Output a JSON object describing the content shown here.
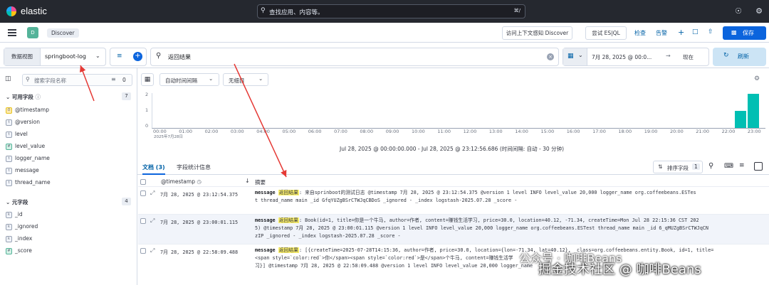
{
  "app": {
    "brand": "elastic"
  },
  "global_search": {
    "placeholder": "查找应用、内容等。",
    "shortcut": "⌘/"
  },
  "subbar": {
    "app_badge": "D",
    "breadcrumb": "Discover",
    "access_button": "访问上下文感知 Discover",
    "esql_button": "尝试 ES|QL",
    "inspect": "检查",
    "alerts": "告警",
    "save": "保存"
  },
  "querybar": {
    "data_view_label": "数据视图",
    "data_view_value": "springboot-log",
    "query": "返回结果",
    "date_start": "7月 28, 2025 @ 00:0...",
    "arrow": "→",
    "date_end": "现在",
    "refresh": "刷新"
  },
  "sidebar": {
    "search_placeholder": "搜索字段名称",
    "filter_count": "0",
    "available_label": "可用字段",
    "available_count": "7",
    "available_fields": [
      {
        "type": "date",
        "name": "@timestamp"
      },
      {
        "type": "t",
        "name": "@version"
      },
      {
        "type": "t",
        "name": "level"
      },
      {
        "type": "#",
        "name": "level_value"
      },
      {
        "type": "t",
        "name": "logger_name"
      },
      {
        "type": "t",
        "name": "message"
      },
      {
        "type": "t",
        "name": "thread_name"
      }
    ],
    "meta_label": "元字段",
    "meta_count": "4",
    "meta_fields": [
      {
        "type": "k",
        "name": "_id"
      },
      {
        "type": "k",
        "name": "_ignored"
      },
      {
        "type": "k",
        "name": "_index"
      },
      {
        "type": "#",
        "name": "_score"
      }
    ]
  },
  "toolbar": {
    "interval": "自动时间间隔",
    "breakdown": "无细目"
  },
  "chart_data": {
    "type": "bar",
    "y_ticks": [
      "2",
      "1",
      "0"
    ],
    "x_ticks": [
      "00:00",
      "01:00",
      "02:00",
      "03:00",
      "04:00",
      "05:00",
      "06:00",
      "07:00",
      "08:00",
      "09:00",
      "10:00",
      "11:00",
      "12:00",
      "13:00",
      "14:00",
      "15:00",
      "16:00",
      "17:00",
      "18:00",
      "19:00",
      "20:00",
      "21:00",
      "22:00",
      "23:00"
    ],
    "x_sub": "2025年7月28日",
    "bars": [
      {
        "x": "22:30",
        "value": 1
      },
      {
        "x": "23:00",
        "value": 2
      }
    ],
    "ylim": [
      0,
      2
    ],
    "caption": "Jul 28, 2025 @ 00:00:00.000 - Jul 28, 2025 @ 23:12:56.686  (时间间隔: 自动 - 30 分钟)"
  },
  "tabs": {
    "docs": "文档 (3)",
    "stats": "字段统计信息"
  },
  "table": {
    "sort_button": "排序字段",
    "sort_count": "1",
    "col_timestamp": "@timestamp",
    "col_summary": "摘要",
    "rows": [
      {
        "ts": "7月 28, 2025 @ 23:12:54.375",
        "line1_pre": "message ",
        "line1_hl": "返回结果",
        "line1_post": ": 来自sprinboot的测试日志 @timestamp 7月 28, 2025 @ 23:12:54.375 @version 1 level INFO level_value 20,000 logger_name org.coffeebeans.ESTes",
        "line2": "t thread_name main _id GfqYUZgBSrCTWJqCBDoS _ignored  -  _index logstash-2025.07.28 _score  -"
      },
      {
        "ts": "7月 28, 2025 @ 23:00:01.115",
        "line1_pre": "message ",
        "line1_hl": "返回结果",
        "line1_post": ": Book(id=1, title=你是一个牛马, author=作者, content=赚钱生活学习, price=30.0, location=40.12, -71.34, createTime=Mon Jul 28 22:15:36 CST 202",
        "line2": "5) @timestamp 7月 28, 2025 @ 23:00:01.115 @version 1 level INFO level_value 20,000 logger_name org.coffeebeans.ESTest thread_name main _id 6_qMUZgBSrCTWJqCN",
        "line3": "zIP _ignored  -  _index logstash-2025.07.28 _score  -"
      },
      {
        "ts": "7月 28, 2025 @ 22:58:09.488",
        "line1_pre": "message ",
        "line1_hl": "返回结果",
        "line1_post": ": [{createTime=2025-07-28T14:15:36, author=作者, price=30.0, location={lon=-71.34, lat=40.12}, _class=org.coffeebeans.entity.Book, id=1, title=",
        "line2": "<span style=`color:red`>你</span><span style=`color:red`>是</span>个牛马, content=赚钱生活学",
        "line3": "习}] @timestamp 7月 28, 2025 @ 22:58:09.488 @version 1 level INFO level_value 20,000 logger_name"
      }
    ]
  },
  "watermark": {
    "line1": "公众号 · 咖啡Beans",
    "line2": "掘金技术社区 @ 咖啡Beans"
  }
}
